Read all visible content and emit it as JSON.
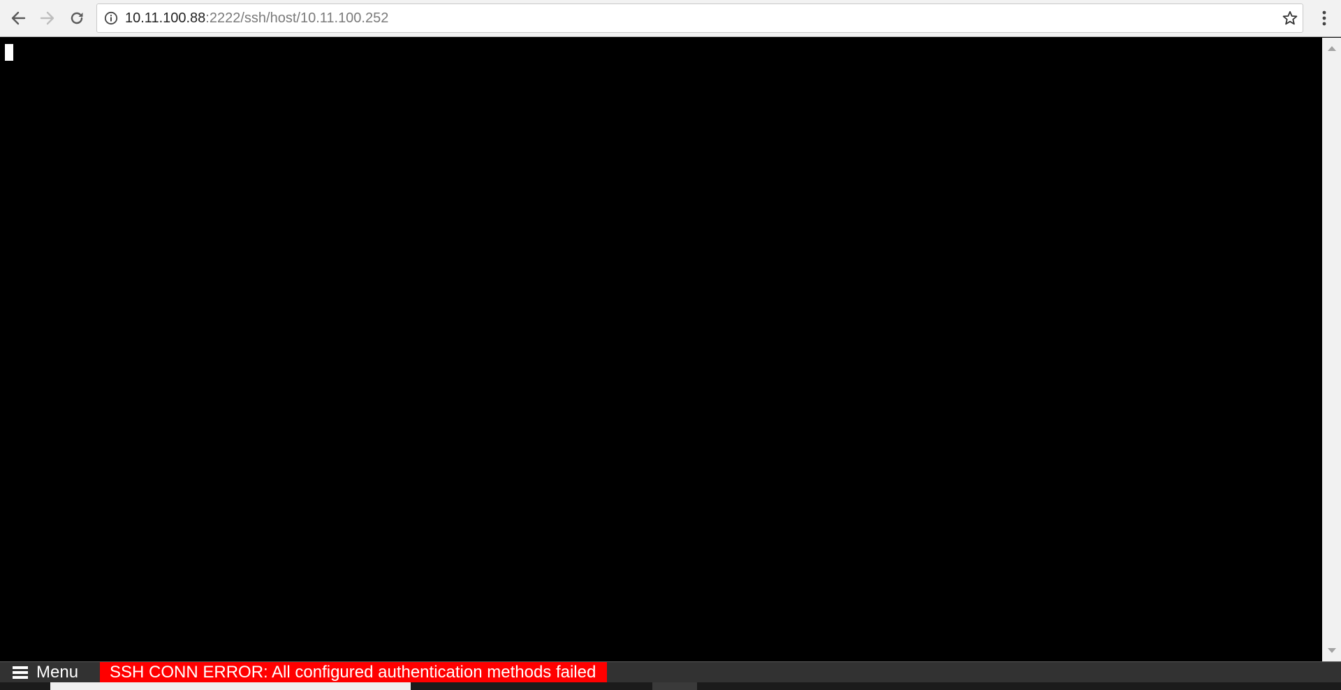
{
  "browser": {
    "url_host": "10.11.100.88",
    "url_rest": ":2222/ssh/host/10.11.100.252",
    "icons": {
      "back": "arrow-left-icon",
      "forward": "arrow-right-icon",
      "reload": "reload-icon",
      "site_info": "info-circle-icon",
      "bookmark": "star-icon",
      "menu": "vertical-dots-icon"
    }
  },
  "terminal": {
    "background_color": "#000000",
    "cursor_color": "#ffffff"
  },
  "status_bar": {
    "menu_label": "Menu",
    "error_message": "SSH CONN ERROR: All configured authentication methods failed",
    "error_color": "#ff0000"
  }
}
